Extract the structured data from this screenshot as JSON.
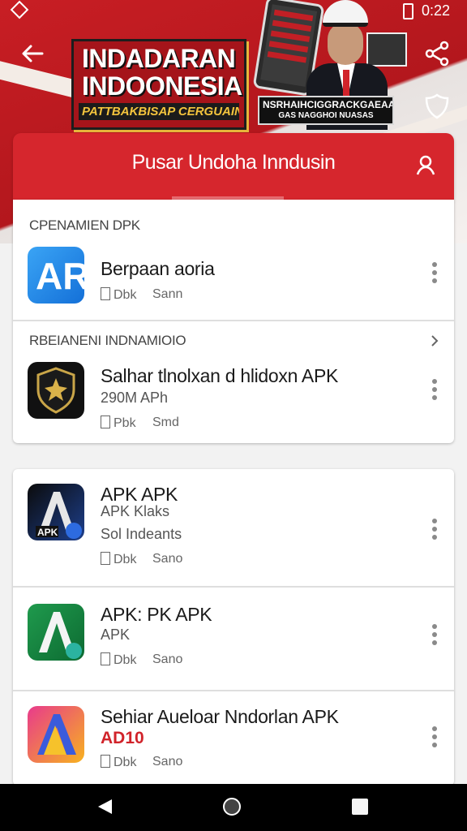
{
  "status_bar": {
    "time": "0:22"
  },
  "hero": {
    "headline_1": "INDADARAN",
    "headline_2": "INDOONESIA",
    "tagline": "PATTBAKBISAP CERGUAIN!",
    "plate_1": "NSRHAIHCIGGRACKGAEAAS",
    "plate_2": "GAS NAGGHOI NUASAS"
  },
  "header": {
    "title": "Pusar Undoha Inndusin"
  },
  "sections": [
    {
      "heading": "CPENAMIEN DPK",
      "apps": [
        {
          "name": "Berpaan aoria",
          "meta_1": "Dbk",
          "meta_2": "Sann"
        }
      ]
    },
    {
      "heading": "RBEIANENI INDNAMIOIO",
      "apps": [
        {
          "name": "Salhar tlnolxan d hlidoxn APK",
          "detail": "290M APh",
          "meta_1": "Pbk",
          "meta_2": "Smd"
        }
      ]
    }
  ],
  "list": [
    {
      "name": "APK APK",
      "detail": "APK  Klaks",
      "detail_2": "Sol Indeants",
      "meta_1": "Dbk",
      "meta_2": "Sano"
    },
    {
      "name": "APK: PK APK",
      "detail": "APK",
      "meta_1": "Dbk",
      "meta_2": "Sano"
    },
    {
      "name": "Sehiar Aueloar Nndorlan APK",
      "detail": "AD10",
      "meta_1": "Dbk",
      "meta_2": "Sano"
    }
  ],
  "colors": {
    "primary": "#d6262d",
    "background": "#f2f2f2"
  },
  "icons": [
    "diamond-icon",
    "battery-icon",
    "back-arrow-icon",
    "share-icon",
    "badge-icon",
    "user-icon",
    "more-vert-icon",
    "chevron-right-icon",
    "nav-back-icon",
    "nav-home-icon",
    "nav-recents-icon"
  ]
}
